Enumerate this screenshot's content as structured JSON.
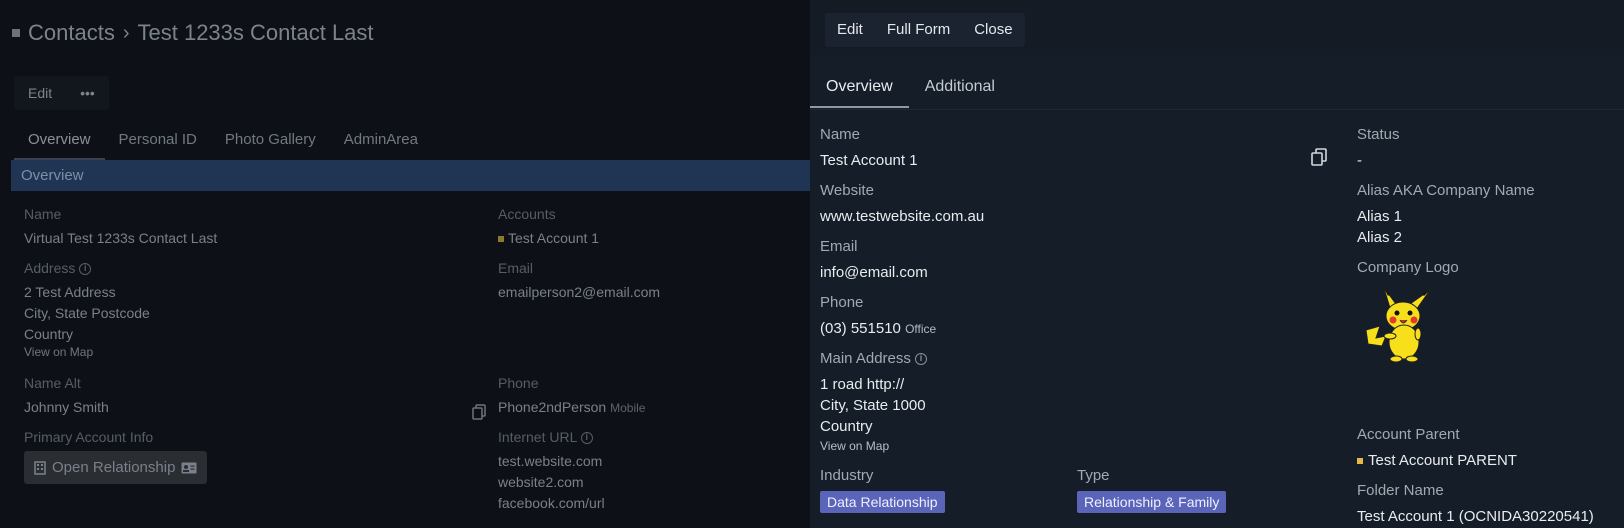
{
  "left": {
    "breadcrumb": {
      "root": "Contacts",
      "separator": "›",
      "current": "Test 1233s Contact Last"
    },
    "toolbar": {
      "edit": "Edit",
      "more": "•••"
    },
    "tabs": [
      "Overview",
      "Personal ID",
      "Photo Gallery",
      "AdminArea"
    ],
    "section_title": "Overview",
    "fields": {
      "name_label": "Name",
      "name_value": "Virtual Test 1233s Contact Last",
      "address_label": "Address",
      "address_lines": [
        "2 Test Address",
        "City, State Postcode",
        "Country"
      ],
      "view_on_map": "View on Map",
      "name_alt_label": "Name Alt",
      "name_alt_value": "Johnny Smith",
      "primary_account_label": "Primary Account Info",
      "open_relationship": "Open Relationship",
      "accounts_label": "Accounts",
      "accounts_value": "Test Account 1",
      "email_label": "Email",
      "email_value": "emailperson2@email.com",
      "phone_label": "Phone",
      "phone_value": "Phone2ndPerson",
      "phone_type": "Mobile",
      "internet_label": "Internet URL",
      "internet_lines": [
        "test.website.com",
        "website2.com",
        "facebook.com/url"
      ]
    }
  },
  "panel": {
    "toolbar": {
      "edit": "Edit",
      "full_form": "Full Form",
      "close": "Close"
    },
    "tabs": [
      "Overview",
      "Additional"
    ],
    "name_label": "Name",
    "name_value": "Test Account 1",
    "website_label": "Website",
    "website_value": "www.testwebsite.com.au",
    "email_label": "Email",
    "email_value": "info@email.com",
    "phone_label": "Phone",
    "phone_value": "(03) 551510",
    "phone_type": "Office",
    "main_address_label": "Main Address",
    "main_address_lines": [
      "1 road http://",
      "City, State 1000",
      "Country"
    ],
    "view_on_map": "View on Map",
    "industry_label": "Industry",
    "industry_value": "Data Relationship",
    "type_label": "Type",
    "type_value": "Relationship & Family",
    "status_label": "Status",
    "status_value": "-",
    "alias_label": "Alias AKA Company Name",
    "alias_lines": [
      "Alias 1",
      "Alias 2"
    ],
    "logo_label": "Company Logo",
    "account_parent_label": "Account Parent",
    "account_parent_value": "Test Account PARENT",
    "folder_label": "Folder Name",
    "folder_value": "Test Account 1 (OCNIDA30220541)"
  },
  "icons": {
    "copy": "copy-icon",
    "info": "info-icon",
    "contact_card": "contact-card-icon",
    "building": "building-icon",
    "logo": "pikachu-logo"
  },
  "colors": {
    "panel_bg": "#151d28",
    "tag_bg": "#5a64b8",
    "account_dot": "#e7b84a",
    "section_bar": "#1f3553"
  }
}
